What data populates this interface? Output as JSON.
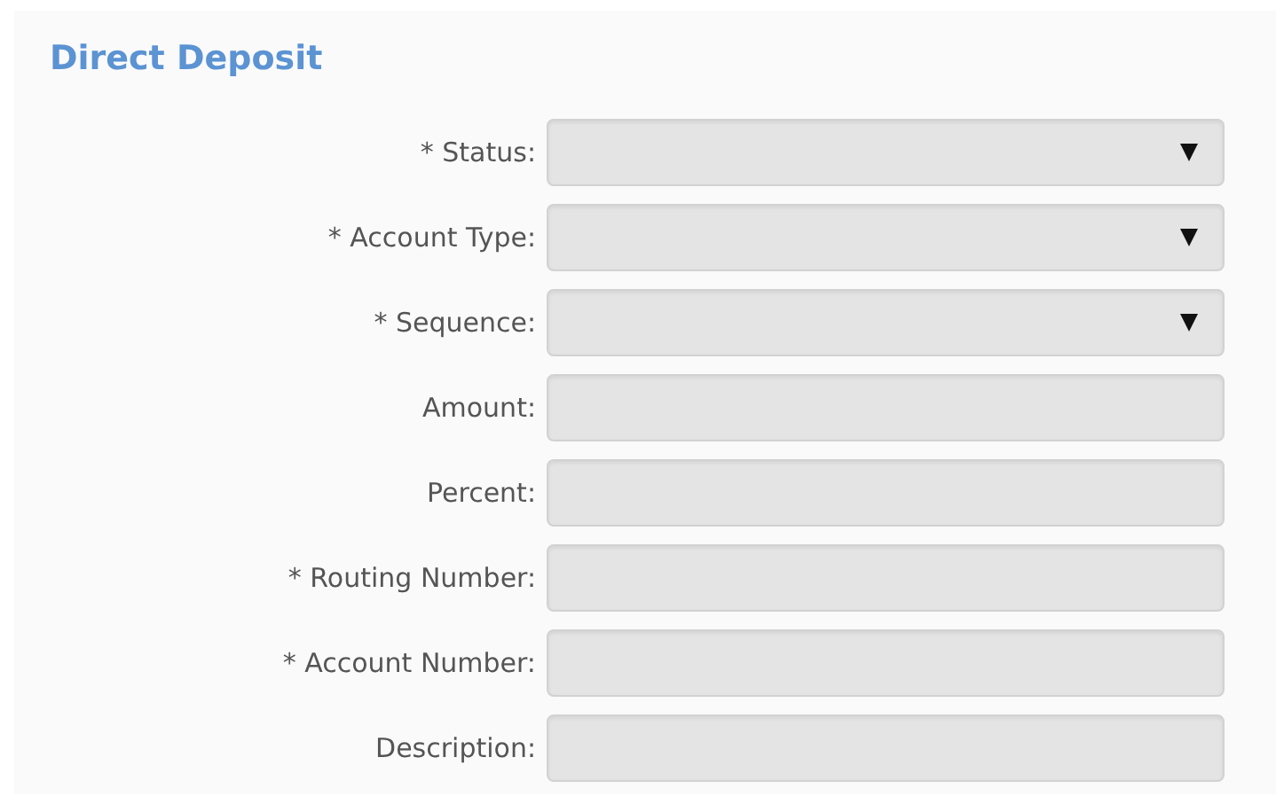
{
  "section": {
    "title": "Direct Deposit"
  },
  "fields": [
    {
      "label": "* Status:",
      "kind": "select"
    },
    {
      "label": "* Account Type:",
      "kind": "select"
    },
    {
      "label": "* Sequence:",
      "kind": "select"
    },
    {
      "label": "Amount:",
      "kind": "text"
    },
    {
      "label": "Percent:",
      "kind": "text"
    },
    {
      "label": "* Routing Number:",
      "kind": "text"
    },
    {
      "label": "* Account Number:",
      "kind": "text"
    },
    {
      "label": "Description:",
      "kind": "text"
    }
  ]
}
